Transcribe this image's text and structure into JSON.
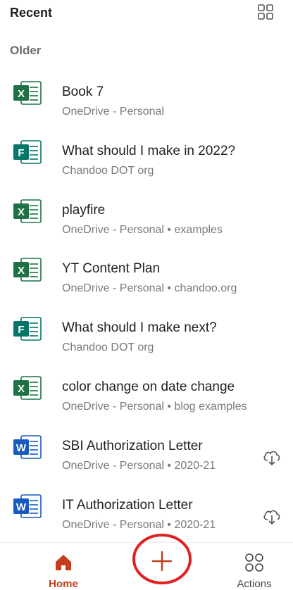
{
  "header": {
    "title": "Recent",
    "layout_icon": "grid-view-icon"
  },
  "section": {
    "label": "Older"
  },
  "files": [
    {
      "title": "Book 7",
      "subtitle": "OneDrive - Personal",
      "app": "excel",
      "letter": "X",
      "color": "#1e7145",
      "cloud": false
    },
    {
      "title": "What should I make in 2022?",
      "subtitle": "Chandoo DOT org",
      "app": "forms",
      "letter": "F",
      "color": "#077568",
      "cloud": false
    },
    {
      "title": "playfire",
      "subtitle": "OneDrive - Personal • examples",
      "app": "excel",
      "letter": "X",
      "color": "#1e7145",
      "cloud": false
    },
    {
      "title": "YT Content Plan",
      "subtitle": "OneDrive - Personal • chandoo.org",
      "app": "excel",
      "letter": "X",
      "color": "#1e7145",
      "cloud": false
    },
    {
      "title": "What should I make next?",
      "subtitle": "Chandoo DOT org",
      "app": "forms",
      "letter": "F",
      "color": "#077568",
      "cloud": false
    },
    {
      "title": "color change on date change",
      "subtitle": "OneDrive - Personal • blog examples",
      "app": "excel",
      "letter": "X",
      "color": "#1e7145",
      "cloud": false
    },
    {
      "title": "SBI Authorization Letter",
      "subtitle": "OneDrive - Personal • 2020-21",
      "app": "word",
      "letter": "W",
      "color": "#185abd",
      "cloud": true
    },
    {
      "title": "IT Authorization Letter",
      "subtitle": "OneDrive - Personal • 2020-21",
      "app": "word",
      "letter": "W",
      "color": "#185abd",
      "cloud": true
    }
  ],
  "bottom_nav": {
    "home_label": "Home",
    "actions_label": "Actions",
    "create_icon": "plus-icon",
    "accent": "#c43e1c"
  }
}
